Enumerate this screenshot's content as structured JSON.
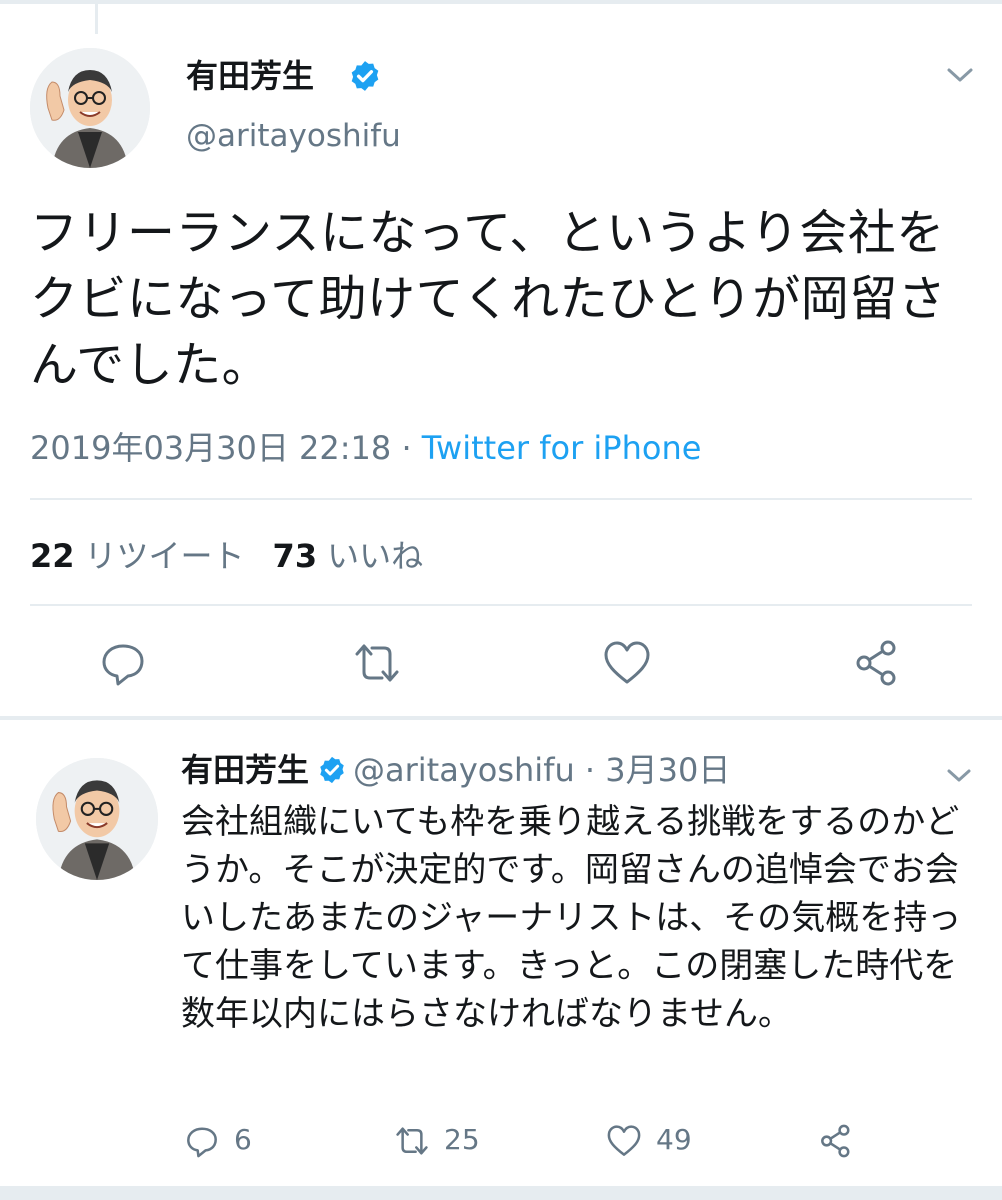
{
  "main_tweet": {
    "name": "有田芳生",
    "handle": "@aritayoshifu",
    "text": "フリーランスになって、というより会社をクビになって助けてくれたひとりが岡留さんでした。",
    "timestamp": "2019年03月30日 22:18",
    "separator": "·",
    "source": "Twitter for iPhone",
    "retweets_count": "22",
    "retweets_label": "リツイート",
    "likes_count": "73",
    "likes_label": "いいね"
  },
  "reply_tweet": {
    "name": "有田芳生",
    "handle": "@aritayoshifu",
    "separator": "·",
    "date": "3月30日",
    "text": "会社組織にいても枠を乗り越える挑戦をするのかどうか。そこが決定的です。岡留さんの追悼会でお会いしたあまたのジャーナリストは、その気概を持って仕事をしています。きっと。この閉塞した時代を数年以内にはらさなければなりません。",
    "reply_count": "6",
    "retweet_count": "25",
    "like_count": "49"
  },
  "icons": {
    "verified": "verified-badge-icon",
    "chevron": "chevron-down-icon",
    "reply": "reply-icon",
    "retweet": "retweet-icon",
    "like": "heart-icon",
    "share": "share-icon"
  },
  "colors": {
    "text": "#14171a",
    "secondary": "#657786",
    "link": "#1da1f2",
    "divider": "#e6ecf0",
    "verified": "#1da1f2"
  }
}
